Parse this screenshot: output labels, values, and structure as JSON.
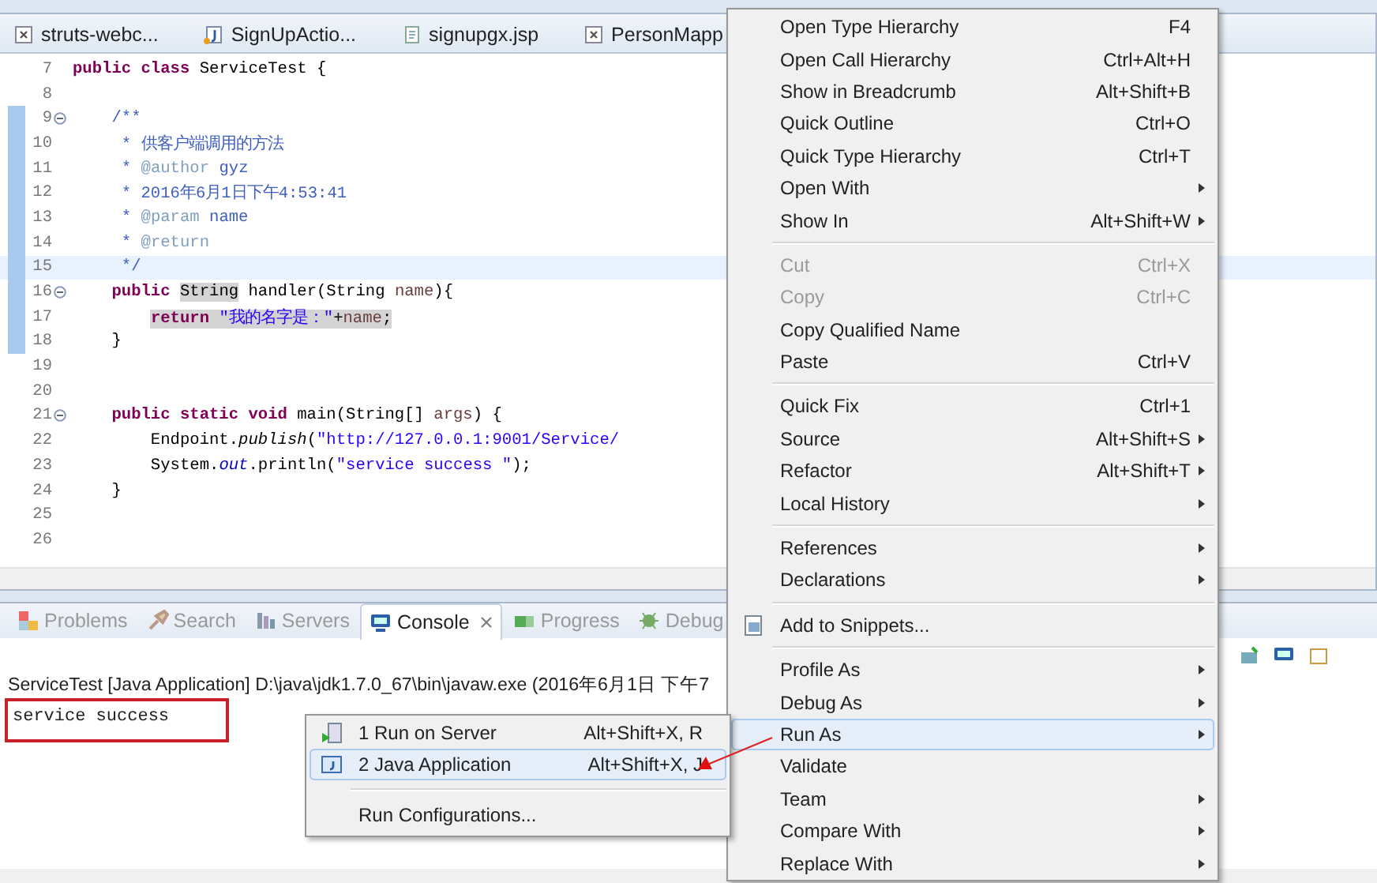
{
  "editor": {
    "tabs": [
      {
        "label": "struts-webc...",
        "kind": "xml",
        "selected": false
      },
      {
        "label": "SignUpActio...",
        "kind": "java",
        "selected": false
      },
      {
        "label": "signupgx.jsp",
        "kind": "jsp",
        "selected": false
      },
      {
        "label": "PersonMapp",
        "kind": "xml",
        "selected": false
      }
    ],
    "lines": [
      {
        "number": "7",
        "changed": false,
        "current": false,
        "foldable": false,
        "highlighted": false,
        "segments": [
          {
            "kind": "kw",
            "text": "public class "
          },
          {
            "kind": "plain",
            "text": "ServiceTest {"
          }
        ]
      },
      {
        "number": "8",
        "changed": false,
        "current": false,
        "foldable": false
      },
      {
        "number": "9",
        "changed": true,
        "current": false,
        "foldable": true,
        "highlighted": false,
        "segments": [
          {
            "kind": "doc",
            "text": "    /**"
          }
        ]
      },
      {
        "number": "10",
        "changed": true,
        "current": false,
        "foldable": false,
        "highlighted": false,
        "segments": [
          {
            "kind": "doc",
            "text": "     * 供客户端调用的方法"
          }
        ]
      },
      {
        "number": "11",
        "changed": true,
        "current": false,
        "foldable": false,
        "highlighted": false,
        "segments": [
          {
            "kind": "doc",
            "text": "     * "
          },
          {
            "kind": "tag",
            "text": "@author"
          },
          {
            "kind": "doc",
            "text": " gyz"
          }
        ]
      },
      {
        "number": "12",
        "changed": true,
        "current": false,
        "foldable": false,
        "highlighted": false,
        "segments": [
          {
            "kind": "doc",
            "text": "     * 2016年6月1日下午4:53:41"
          }
        ]
      },
      {
        "number": "13",
        "changed": true,
        "current": false,
        "foldable": false,
        "highlighted": false,
        "segments": [
          {
            "kind": "doc",
            "text": "     * "
          },
          {
            "kind": "tag",
            "text": "@param"
          },
          {
            "kind": "doc",
            "text": " name"
          }
        ]
      },
      {
        "number": "14",
        "changed": true,
        "current": false,
        "foldable": false,
        "highlighted": false,
        "segments": [
          {
            "kind": "doc",
            "text": "     * "
          },
          {
            "kind": "tag",
            "text": "@return"
          }
        ]
      },
      {
        "number": "15",
        "changed": true,
        "current": true,
        "foldable": false,
        "highlighted": false,
        "segments": [
          {
            "kind": "doc",
            "text": "     */"
          }
        ]
      },
      {
        "number": "16",
        "changed": true,
        "current": false,
        "foldable": true,
        "highlighted": false,
        "segments": [
          {
            "kind": "kw",
            "text": "    public "
          },
          {
            "kind": "occ",
            "text": "String"
          },
          {
            "kind": "plain",
            "text": " handler(String "
          },
          {
            "kind": "param",
            "text": "name"
          },
          {
            "kind": "plain",
            "text": "){"
          }
        ]
      },
      {
        "number": "17",
        "changed": true,
        "current": false,
        "foldable": false,
        "highlighted": true,
        "segments": [
          {
            "kind": "kw",
            "text": "        return "
          },
          {
            "kind": "str",
            "text": "\"我的名字是：\""
          },
          {
            "kind": "plain",
            "text": "+"
          },
          {
            "kind": "param",
            "text": "name"
          },
          {
            "kind": "plain",
            "text": ";"
          }
        ]
      },
      {
        "number": "18",
        "changed": true,
        "current": false,
        "foldable": false,
        "highlighted": false,
        "segments": [
          {
            "kind": "plain",
            "text": "    }"
          }
        ]
      },
      {
        "number": "19",
        "changed": false,
        "current": false,
        "foldable": false
      },
      {
        "number": "20",
        "changed": false,
        "current": false,
        "foldable": false
      },
      {
        "number": "21",
        "changed": false,
        "current": false,
        "foldable": true,
        "highlighted": false,
        "segments": [
          {
            "kind": "kw",
            "text": "    public static void "
          },
          {
            "kind": "plain",
            "text": "main(String[] "
          },
          {
            "kind": "param",
            "text": "args"
          },
          {
            "kind": "plain",
            "text": ") {"
          }
        ]
      },
      {
        "number": "22",
        "changed": false,
        "current": false,
        "foldable": false,
        "highlighted": false,
        "segments": [
          {
            "kind": "plain",
            "text": "        Endpoint."
          },
          {
            "kind": "italic",
            "text": "publish"
          },
          {
            "kind": "plain",
            "text": "("
          },
          {
            "kind": "str",
            "text": "\"http://127.0.0.1:9001/Service/"
          }
        ]
      },
      {
        "number": "23",
        "changed": false,
        "current": false,
        "foldable": false,
        "highlighted": false,
        "segments": [
          {
            "kind": "plain",
            "text": "        System."
          },
          {
            "kind": "field",
            "text": "out"
          },
          {
            "kind": "plain",
            "text": ".println("
          },
          {
            "kind": "str",
            "text": "\"service success \""
          },
          {
            "kind": "plain",
            "text": ");"
          }
        ]
      },
      {
        "number": "24",
        "changed": false,
        "current": false,
        "foldable": false,
        "highlighted": false,
        "segments": [
          {
            "kind": "plain",
            "text": "    }"
          }
        ]
      },
      {
        "number": "25",
        "changed": false,
        "current": false,
        "foldable": false
      },
      {
        "number": "26",
        "changed": false,
        "current": false,
        "foldable": false
      }
    ]
  },
  "bottom_panel": {
    "tabs": [
      {
        "label": "Problems",
        "kind": "problems",
        "selected": false
      },
      {
        "label": "Search",
        "kind": "search",
        "selected": false
      },
      {
        "label": "Servers",
        "kind": "servers",
        "selected": false
      },
      {
        "label": "Console",
        "kind": "console",
        "selected": true
      },
      {
        "label": "Progress",
        "kind": "progress",
        "selected": false
      },
      {
        "label": "Debug",
        "kind": "debug",
        "selected": false
      }
    ],
    "console_header": "ServiceTest [Java Application] D:\\java\\jdk1.7.0_67\\bin\\javaw.exe (2016年6月1日 下午7",
    "output": "service success"
  },
  "context_menu": {
    "groups": [
      [
        {
          "label": "Open Type Hierarchy",
          "shortcut": "F4",
          "submenu": false,
          "disabled": false,
          "selected": false
        },
        {
          "label": "Open Call Hierarchy",
          "shortcut": "Ctrl+Alt+H",
          "submenu": false,
          "disabled": false,
          "selected": false
        },
        {
          "label": "Show in Breadcrumb",
          "shortcut": "Alt+Shift+B",
          "submenu": false,
          "disabled": false,
          "selected": false
        },
        {
          "label": "Quick Outline",
          "shortcut": "Ctrl+O",
          "submenu": false,
          "disabled": false,
          "selected": false
        },
        {
          "label": "Quick Type Hierarchy",
          "shortcut": "Ctrl+T",
          "submenu": false,
          "disabled": false,
          "selected": false
        },
        {
          "label": "Open With",
          "submenu": true,
          "disabled": false,
          "selected": false
        },
        {
          "label": "Show In",
          "shortcut": "Alt+Shift+W",
          "submenu": true,
          "disabled": false,
          "selected": false
        }
      ],
      [
        {
          "label": "Cut",
          "shortcut": "Ctrl+X",
          "submenu": false,
          "disabled": true,
          "selected": false
        },
        {
          "label": "Copy",
          "shortcut": "Ctrl+C",
          "submenu": false,
          "disabled": true,
          "selected": false
        },
        {
          "label": "Copy Qualified Name",
          "submenu": false,
          "disabled": false,
          "selected": false
        },
        {
          "label": "Paste",
          "shortcut": "Ctrl+V",
          "submenu": false,
          "disabled": false,
          "selected": false
        }
      ],
      [
        {
          "label": "Quick Fix",
          "shortcut": "Ctrl+1",
          "submenu": false,
          "disabled": false,
          "selected": false
        },
        {
          "label": "Source",
          "shortcut": "Alt+Shift+S",
          "submenu": true,
          "disabled": false,
          "selected": false
        },
        {
          "label": "Refactor",
          "shortcut": "Alt+Shift+T",
          "submenu": true,
          "disabled": false,
          "selected": false
        },
        {
          "label": "Local History",
          "submenu": true,
          "disabled": false,
          "selected": false
        }
      ],
      [
        {
          "label": "References",
          "submenu": true,
          "disabled": false,
          "selected": false
        },
        {
          "label": "Declarations",
          "submenu": true,
          "disabled": false,
          "selected": false
        }
      ],
      [
        {
          "label": "Add to Snippets...",
          "icon": true,
          "submenu": false,
          "disabled": false,
          "selected": false
        }
      ],
      [
        {
          "label": "Profile As",
          "submenu": true,
          "disabled": false,
          "selected": false
        },
        {
          "label": "Debug As",
          "submenu": true,
          "disabled": false,
          "selected": false
        },
        {
          "label": "Run As",
          "submenu": true,
          "disabled": false,
          "selected": true
        },
        {
          "label": "Validate",
          "submenu": false,
          "disabled": false,
          "selected": false
        },
        {
          "label": "Team",
          "submenu": true,
          "disabled": false,
          "selected": false
        },
        {
          "label": "Compare With",
          "submenu": true,
          "disabled": false,
          "selected": false
        },
        {
          "label": "Replace With",
          "submenu": true,
          "disabled": false,
          "selected": false
        }
      ]
    ]
  },
  "run_as_submenu": {
    "groups": [
      [
        {
          "label": "1 Run on Server",
          "shortcut": "Alt+Shift+X, R",
          "kind": "server",
          "selected": false
        },
        {
          "label": "2 Java Application",
          "shortcut": "Alt+Shift+X, J",
          "kind": "java",
          "selected": true
        }
      ],
      [
        {
          "label": "Run Configurations...",
          "kind": "plain",
          "selected": false
        }
      ]
    ]
  }
}
